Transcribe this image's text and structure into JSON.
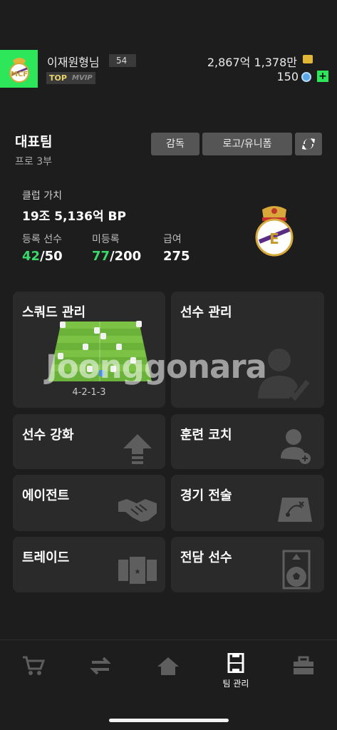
{
  "profile": {
    "username": "이재원형님",
    "level": "54",
    "badge_top": "TOP",
    "badge_vip": "VIP",
    "money": "2,867억 1,378만",
    "coins": "150"
  },
  "team": {
    "name": "대표팀",
    "division": "프로 3부",
    "coach_button": "감독",
    "logo_button": "로고/유니폼"
  },
  "club": {
    "value_label": "클럽 가치",
    "value": "19조 5,136억 BP",
    "registered_label": "등록 선수",
    "registered_current": "42",
    "registered_max": "/50",
    "unregistered_label": "미등록",
    "unregistered_current": "77",
    "unregistered_max": "/200",
    "salary_label": "급여",
    "salary": "275"
  },
  "tiles": {
    "squad": "스쿼드 관리",
    "formation": "4-2-1-3",
    "players": "선수 관리",
    "enhance": "선수 강화",
    "coach": "훈련 코치",
    "agent": "에이전트",
    "tactics": "경기 전술",
    "trade": "트레이드",
    "exclusive": "전담 선수"
  },
  "watermark": "Joonggonara",
  "nav": {
    "items": [
      {
        "icon": "cart-icon",
        "label": ""
      },
      {
        "icon": "transfer-icon",
        "label": ""
      },
      {
        "icon": "home-icon",
        "label": ""
      },
      {
        "icon": "pitch-icon",
        "label": "팀 관리"
      },
      {
        "icon": "briefcase-icon",
        "label": ""
      }
    ]
  },
  "colors": {
    "background": "#1d1d1d",
    "tile": "#2a2a2a",
    "accent_green": "#2ee65a",
    "stat_green": "#39d96a",
    "button": "#555555",
    "gold": "#e3b734"
  }
}
